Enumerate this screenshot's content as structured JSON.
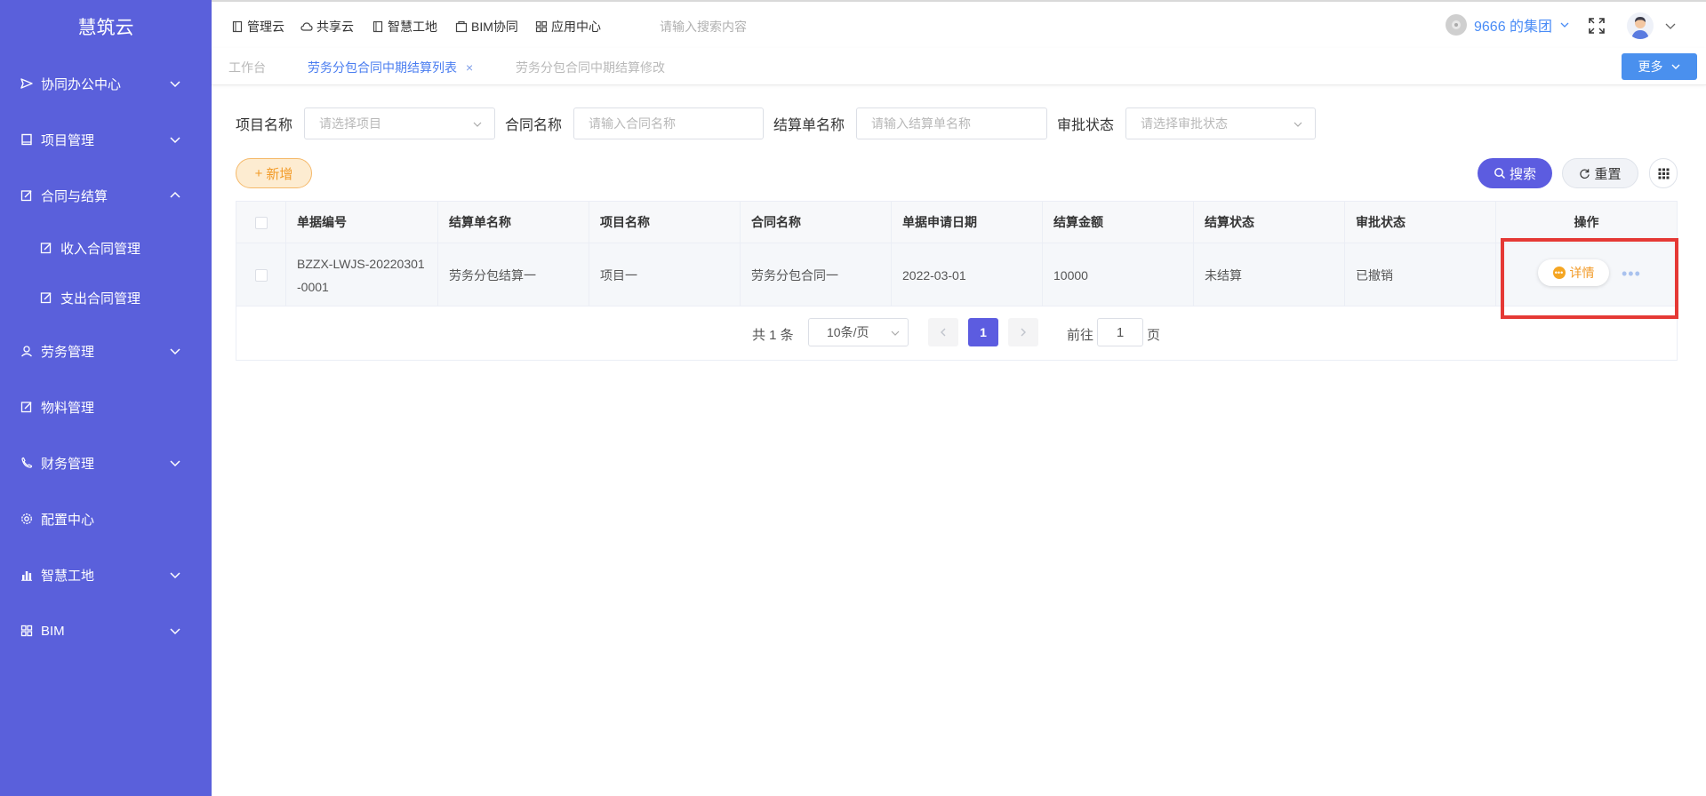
{
  "sidebar": {
    "logo": "慧筑云",
    "items": [
      {
        "label": "协同办公中心",
        "icon": "send-icon",
        "expand": "down"
      },
      {
        "label": "项目管理",
        "icon": "book-icon",
        "expand": "down"
      },
      {
        "label": "合同与结算",
        "icon": "edit-icon",
        "expand": "up"
      },
      {
        "label": "收入合同管理",
        "icon": "edit-icon",
        "expand": ""
      },
      {
        "label": "支出合同管理",
        "icon": "edit-icon",
        "expand": ""
      },
      {
        "label": "劳务管理",
        "icon": "worker-icon",
        "expand": "down"
      },
      {
        "label": "物料管理",
        "icon": "edit-icon",
        "expand": ""
      },
      {
        "label": "财务管理",
        "icon": "phone-icon",
        "expand": "down"
      },
      {
        "label": "配置中心",
        "icon": "gear-icon",
        "expand": ""
      },
      {
        "label": "智慧工地",
        "icon": "bar-chart-icon",
        "expand": "down"
      },
      {
        "label": "BIM",
        "icon": "grid-icon",
        "expand": "down"
      }
    ]
  },
  "topbar": {
    "nav": [
      "管理云",
      "共享云",
      "智慧工地",
      "BIM协同",
      "应用中心"
    ],
    "search_placeholder": "请输入搜索内容",
    "group": "9666 的集团"
  },
  "tabs": {
    "items": [
      "工作台",
      "劳务分包合同中期结算列表",
      "劳务分包合同中期结算修改"
    ],
    "close": "×",
    "more": "更多"
  },
  "filters": {
    "project_label": "项目名称",
    "project_placeholder": "请选择项目",
    "contract_label": "合同名称",
    "contract_placeholder": "请输入合同名称",
    "settle_label": "结算单名称",
    "settle_placeholder": "请输入结算单名称",
    "approve_label": "审批状态",
    "approve_placeholder": "请选择审批状态"
  },
  "actions": {
    "add": "新增",
    "search": "搜索",
    "reset": "重置"
  },
  "table": {
    "headers": [
      "单据编号",
      "结算单名称",
      "项目名称",
      "合同名称",
      "单据申请日期",
      "结算金额",
      "结算状态",
      "审批状态",
      "操作"
    ],
    "rows": [
      {
        "code_line1": "BZZX-LWJS-20220301",
        "code_line2": "-0001",
        "settle_name": "劳务分包结算一",
        "project": "项目一",
        "contract": "劳务分包合同一",
        "date": "2022-03-01",
        "amount": "10000",
        "settle_status": "未结算",
        "approve_status": "已撤销",
        "detail": "详情",
        "more": "•••"
      }
    ]
  },
  "pagination": {
    "total": "共 1 条",
    "page_size": "10条/页",
    "current": "1",
    "goto_label": "前往",
    "goto_value": "1",
    "page_label": "页"
  },
  "colors": {
    "sidebar": "#5a60db",
    "primary": "#5c5ce0",
    "warning": "#f29b28",
    "highlight": "#e53935"
  }
}
